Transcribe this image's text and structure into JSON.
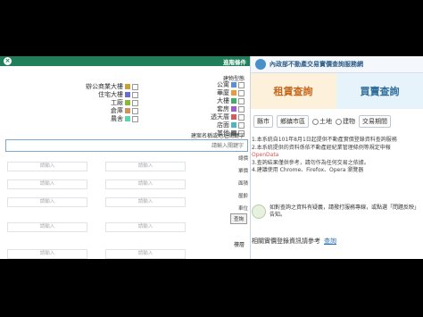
{
  "site": {
    "title": "內政部不動產交易實價查詢服務網",
    "banner_left": "租賃查詢",
    "banner_right": "買賣查詢"
  },
  "toolbar": {
    "selects": [
      "縣市",
      "鄉鎮市區",
      "交易期間"
    ],
    "radios": [
      "土地",
      "建物"
    ]
  },
  "notice": {
    "lines": [
      "1.本系統自101年8月1日起提供不動產實價登錄資料查詢服務",
      "2.本系統提供的資料係依不動產經紀業管理條例等規定申報",
      "3.查詢結果僅供參考，請勿作為任何交易之依據。",
      "4.建議使用 Chrome、Firefox、Opera 瀏覽器"
    ],
    "highlight": "OpenData"
  },
  "tip": {
    "text": "如對查詢之資料有疑義，請撥打服務專線，或點選「問題反映」告知。",
    "text2": "查詢實價登錄資料時，請注意相關說明。"
  },
  "subline": {
    "prefix": "相關實價登錄資訊請參考",
    "link": "查詢"
  },
  "panel": {
    "title": "進階條件",
    "close_label": "×",
    "section_type": "建物型態",
    "categories": [
      {
        "label": "公寓",
        "color": "#5b8fd6"
      },
      {
        "label": "華廈",
        "color": "#e89b3a"
      },
      {
        "label": "大樓",
        "color": "#3fae6a"
      },
      {
        "label": "套房",
        "color": "#a15bc9"
      },
      {
        "label": "透天厝",
        "color": "#d65b5b"
      },
      {
        "label": "店面",
        "color": "#4bb7c4"
      },
      {
        "label": "其他",
        "color": "#7a7a7a"
      }
    ],
    "categories2": [
      {
        "label": "辦公商業大樓",
        "color": "#c9a13b"
      },
      {
        "label": "住宅大樓",
        "color": "#6b6bd6"
      },
      {
        "label": "工廠",
        "color": "#8bb83b"
      },
      {
        "label": "倉庫",
        "color": "#d68f5b"
      },
      {
        "label": "農舍",
        "color": "#5bd6a8"
      }
    ],
    "section_keyword": "建案名稱或地址關鍵字",
    "search_placeholder": "請輸入關鍵字",
    "field_placeholder": "請輸入",
    "side_items": [
      "總價",
      "單價",
      "面積",
      "屋齡",
      "車位"
    ],
    "section_price": "單價",
    "section_floor": "樓層",
    "query_label": "查詢"
  }
}
